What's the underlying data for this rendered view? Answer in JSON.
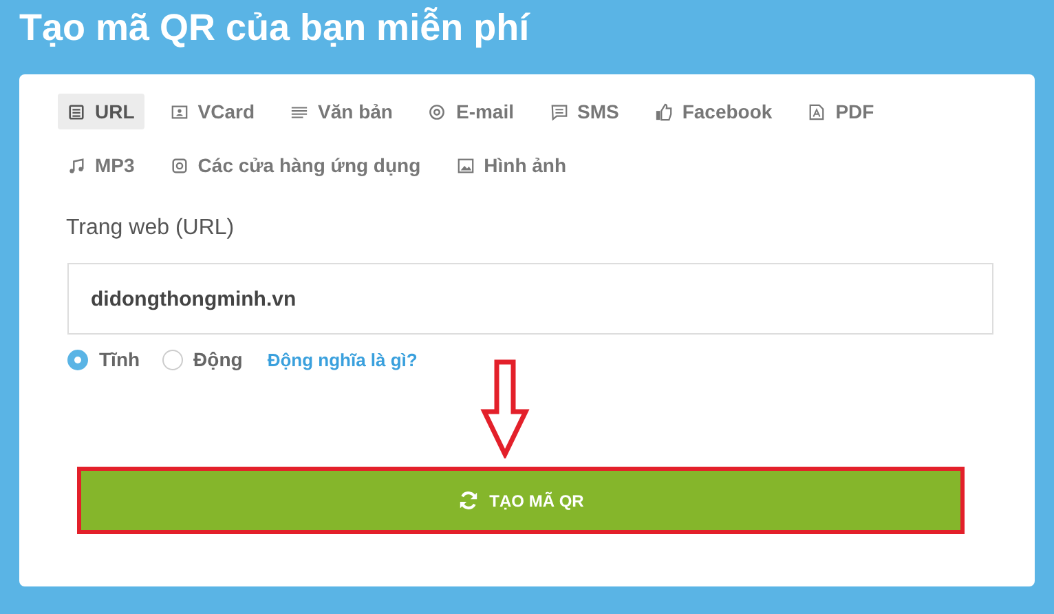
{
  "title": "Tạo mã QR của bạn miễn phí",
  "tabs": [
    {
      "label": "URL",
      "kind": "url",
      "selected": true
    },
    {
      "label": "VCard",
      "kind": "vcard",
      "selected": false
    },
    {
      "label": "Văn bản",
      "kind": "text",
      "selected": false
    },
    {
      "label": "E-mail",
      "kind": "email",
      "selected": false
    },
    {
      "label": "SMS",
      "kind": "sms",
      "selected": false
    },
    {
      "label": "Facebook",
      "kind": "facebook",
      "selected": false
    },
    {
      "label": "PDF",
      "kind": "pdf",
      "selected": false
    },
    {
      "label": "MP3",
      "kind": "mp3",
      "selected": false
    },
    {
      "label": "Các cửa hàng ứng dụng",
      "kind": "store",
      "selected": false
    },
    {
      "label": "Hình ảnh",
      "kind": "image",
      "selected": false
    }
  ],
  "field": {
    "label": "Trang web (URL)",
    "value": "didongthongminh.vn"
  },
  "radios": [
    {
      "label": "Tĩnh",
      "selected": true
    },
    {
      "label": "Động",
      "selected": false
    }
  ],
  "help_link": "Động nghĩa là gì?",
  "button": {
    "label": "TẠO MÃ QR"
  }
}
